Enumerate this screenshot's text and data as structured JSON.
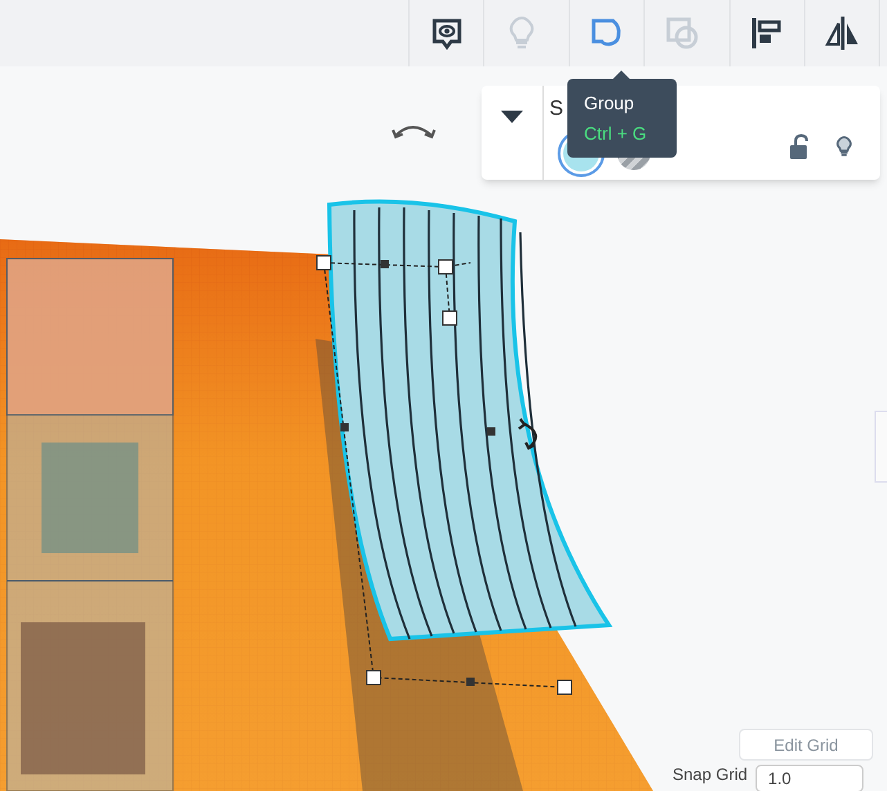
{
  "toolbar": {
    "buttons": [
      {
        "kind": "notes",
        "disabled": false,
        "highlighted": false
      },
      {
        "kind": "bulb",
        "disabled": true,
        "highlighted": false
      },
      {
        "kind": "group",
        "disabled": false,
        "highlighted": true
      },
      {
        "kind": "ungroup",
        "disabled": true,
        "highlighted": false
      },
      {
        "kind": "align",
        "disabled": false,
        "highlighted": false
      },
      {
        "kind": "mirror",
        "disabled": false,
        "highlighted": false
      }
    ]
  },
  "tooltip": {
    "title": "Group",
    "shortcut": "Ctrl + G"
  },
  "inspector": {
    "title": "S",
    "swatches": [
      {
        "kind": "solid",
        "selected": true
      },
      {
        "kind": "hole",
        "selected": false
      }
    ],
    "locked": false
  },
  "grid": {
    "edit_button": "Edit Grid",
    "snap_label": "Snap Grid",
    "snap_value": "1.0"
  }
}
